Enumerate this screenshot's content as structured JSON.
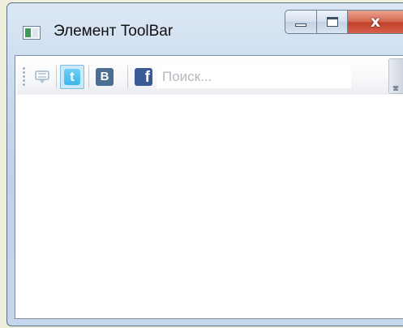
{
  "window": {
    "title": "Элемент ToolBar",
    "close_glyph": "x"
  },
  "toolbar": {
    "buttons": [
      {
        "name": "comments",
        "icon": "comment-icon"
      },
      {
        "name": "twitter",
        "icon": "twitter-icon",
        "glyph": "t",
        "selected": true
      },
      {
        "name": "vkontakte",
        "icon": "vk-icon",
        "glyph": "B"
      },
      {
        "name": "facebook",
        "icon": "facebook-icon",
        "glyph": "f"
      }
    ],
    "search": {
      "value": "",
      "placeholder": "Поиск..."
    }
  },
  "colors": {
    "selected_button_bg": "#cde8f8",
    "selected_button_border": "#7fbde6",
    "vk_brand": "#4c6e92",
    "facebook_brand": "#3b5b98",
    "twitter_brand": "#3cb5ea",
    "close_button": "#c2402a"
  }
}
